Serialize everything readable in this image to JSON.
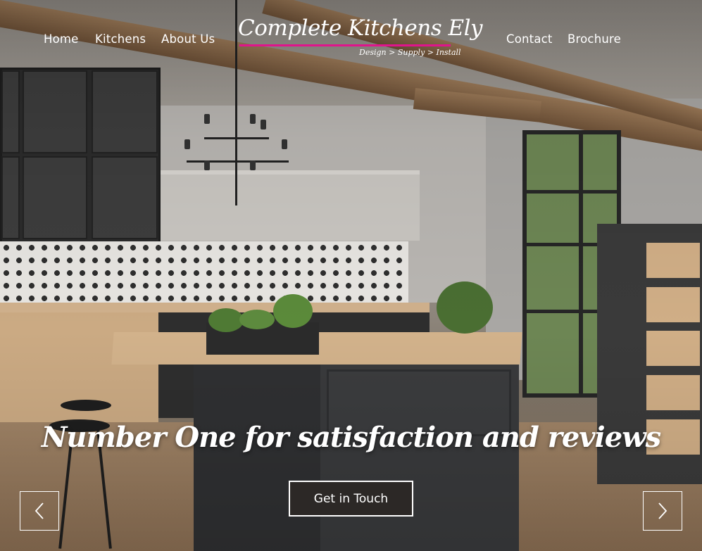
{
  "nav": {
    "left": [
      "Home",
      "Kitchens",
      "About Us"
    ],
    "right": [
      "Contact",
      "Brochure"
    ]
  },
  "logo": {
    "title": "Complete Kitchens Ely",
    "tagline": "Design > Supply > Install",
    "accent_color": "#e0148c"
  },
  "hero": {
    "headline": "Number One for satisfaction and reviews",
    "cta_label": "Get in Touch"
  },
  "carousel": {
    "prev_icon": "chevron-left-icon",
    "next_icon": "chevron-right-icon"
  }
}
